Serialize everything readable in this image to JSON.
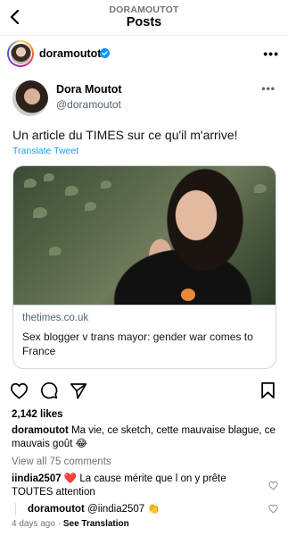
{
  "header": {
    "account": "DORAMOUTOT",
    "title": "Posts",
    "back_icon": "chevron-left-icon"
  },
  "post": {
    "username": "doramoutot",
    "verified_icon": "verified-badge-icon",
    "more_icon": "more-horizontal-icon"
  },
  "tweet": {
    "name": "Dora Moutot",
    "handle": "@doramoutot",
    "text": "Un article du TIMES sur ce qu'il m'arrive!",
    "translate": "Translate Tweet",
    "link": {
      "domain": "thetimes.co.uk",
      "title": "Sex blogger v trans mayor: gender war comes to France"
    }
  },
  "actions": {
    "like_icon": "heart-icon",
    "comment_icon": "comment-icon",
    "share_icon": "send-icon",
    "save_icon": "bookmark-icon"
  },
  "likes": "2,142 likes",
  "caption": {
    "username": "doramoutot",
    "text": "Ma vie, ce sketch, cette mauvaise blague, ce mauvais goût 😂"
  },
  "view_all": "View all 75 comments",
  "comments": [
    {
      "username": "iindia2507",
      "text": "❤️ La cause mérite que l on y prête TOUTES attention"
    },
    {
      "username": "doramoutot",
      "text": "@iindia2507 👏"
    }
  ],
  "meta": {
    "time": "4 days ago",
    "separator": "·",
    "see_translation": "See Translation"
  },
  "colors": {
    "link_blue": "#1d9bf0",
    "verified_blue": "#0095f6",
    "muted": "#737373"
  }
}
